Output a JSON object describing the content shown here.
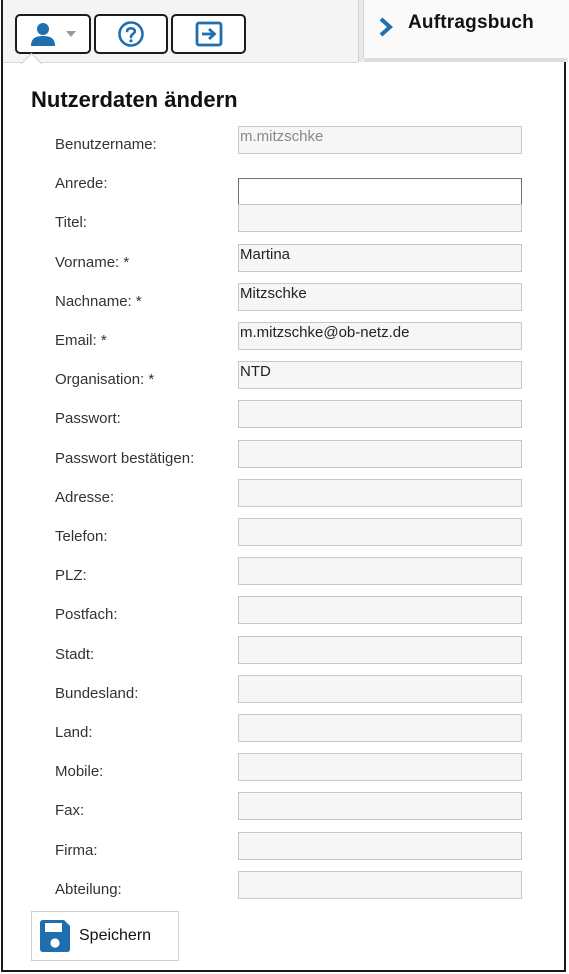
{
  "toolbar": {
    "user_icon": "user-icon",
    "help_icon": "help-circle-icon",
    "logout_icon": "logout-icon"
  },
  "tab": {
    "label": "Auftragsbuch",
    "icon": "chevron-right-icon"
  },
  "form": {
    "title": "Nutzerdaten ändern",
    "fields": [
      {
        "key": "benutzername",
        "label": "Benutzername:",
        "value": "m.mitzschke",
        "state": "readonly"
      },
      {
        "key": "anrede",
        "label": "Anrede:",
        "value": "",
        "state": "focused"
      },
      {
        "key": "titel",
        "label": "Titel:",
        "value": ""
      },
      {
        "key": "vorname",
        "label": "Vorname: *",
        "value": "Martina"
      },
      {
        "key": "nachname",
        "label": "Nachname: *",
        "value": "Mitzschke"
      },
      {
        "key": "email",
        "label": "Email: *",
        "value": "m.mitzschke@ob-netz.de"
      },
      {
        "key": "organisation",
        "label": "Organisation: *",
        "value": "NTD"
      },
      {
        "key": "passwort",
        "label": "Passwort:",
        "value": ""
      },
      {
        "key": "passwort_bestaetigen",
        "label": "Passwort bestätigen:",
        "value": ""
      },
      {
        "key": "adresse",
        "label": "Adresse:",
        "value": ""
      },
      {
        "key": "telefon",
        "label": "Telefon:",
        "value": ""
      },
      {
        "key": "plz",
        "label": "PLZ:",
        "value": ""
      },
      {
        "key": "postfach",
        "label": "Postfach:",
        "value": ""
      },
      {
        "key": "stadt",
        "label": "Stadt:",
        "value": ""
      },
      {
        "key": "bundesland",
        "label": "Bundesland:",
        "value": ""
      },
      {
        "key": "land",
        "label": "Land:",
        "value": ""
      },
      {
        "key": "mobile",
        "label": "Mobile:",
        "value": ""
      },
      {
        "key": "fax",
        "label": "Fax:",
        "value": ""
      },
      {
        "key": "firma",
        "label": "Firma:",
        "value": ""
      },
      {
        "key": "abteilung",
        "label": "Abteilung:",
        "value": ""
      }
    ]
  },
  "save": {
    "label": "Speichern",
    "icon": "floppy-disk-icon"
  },
  "colors": {
    "accent": "#1f6fb0",
    "border": "#1c1c1c",
    "input_border": "#c8c8c8"
  }
}
